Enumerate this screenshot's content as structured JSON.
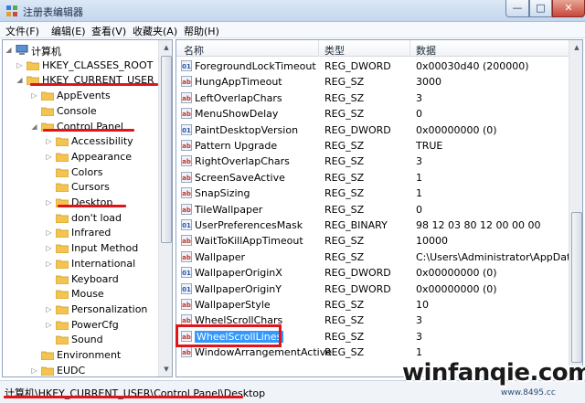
{
  "window": {
    "title": "注册表编辑器",
    "min_glyph": "—",
    "max_glyph": "□",
    "close_glyph": "✕"
  },
  "menu": [
    "文件(F)",
    "编辑(E)",
    "查看(V)",
    "收藏夹(A)",
    "帮助(H)"
  ],
  "tree": [
    {
      "label": "计算机",
      "level": 0,
      "expander": "◢",
      "icon": "computer-icon"
    },
    {
      "label": "HKEY_CLASSES_ROOT",
      "level": 1,
      "expander": "▷",
      "icon": "folder-icon"
    },
    {
      "label": "HKEY_CURRENT_USER",
      "level": 1,
      "expander": "◢",
      "icon": "folder-icon"
    },
    {
      "label": "AppEvents",
      "level": 2,
      "expander": "▷",
      "icon": "folder-icon"
    },
    {
      "label": "Console",
      "level": 2,
      "expander": "",
      "icon": "folder-icon"
    },
    {
      "label": "Control Panel",
      "level": 2,
      "expander": "◢",
      "icon": "folder-icon"
    },
    {
      "label": "Accessibility",
      "level": 3,
      "expander": "▷",
      "icon": "folder-icon"
    },
    {
      "label": "Appearance",
      "level": 3,
      "expander": "▷",
      "icon": "folder-icon"
    },
    {
      "label": "Colors",
      "level": 3,
      "expander": "",
      "icon": "folder-icon"
    },
    {
      "label": "Cursors",
      "level": 3,
      "expander": "",
      "icon": "folder-icon"
    },
    {
      "label": "Desktop",
      "level": 3,
      "expander": "▷",
      "icon": "folder-icon"
    },
    {
      "label": "don't load",
      "level": 3,
      "expander": "",
      "icon": "folder-icon"
    },
    {
      "label": "Infrared",
      "level": 3,
      "expander": "▷",
      "icon": "folder-icon"
    },
    {
      "label": "Input Method",
      "level": 3,
      "expander": "▷",
      "icon": "folder-icon"
    },
    {
      "label": "International",
      "level": 3,
      "expander": "▷",
      "icon": "folder-icon"
    },
    {
      "label": "Keyboard",
      "level": 3,
      "expander": "",
      "icon": "folder-icon"
    },
    {
      "label": "Mouse",
      "level": 3,
      "expander": "",
      "icon": "folder-icon"
    },
    {
      "label": "Personalization",
      "level": 3,
      "expander": "▷",
      "icon": "folder-icon"
    },
    {
      "label": "PowerCfg",
      "level": 3,
      "expander": "▷",
      "icon": "folder-icon"
    },
    {
      "label": "Sound",
      "level": 3,
      "expander": "",
      "icon": "folder-icon"
    },
    {
      "label": "Environment",
      "level": 2,
      "expander": "",
      "icon": "folder-icon"
    },
    {
      "label": "EUDC",
      "level": 2,
      "expander": "▷",
      "icon": "folder-icon"
    }
  ],
  "columns": {
    "name": "名称",
    "type": "类型",
    "data": "数据"
  },
  "values": [
    {
      "name": "ForegroundLockTimeout",
      "type": "REG_DWORD",
      "data": "0x00030d40 (200000)",
      "icon": "bin"
    },
    {
      "name": "HungAppTimeout",
      "type": "REG_SZ",
      "data": "3000",
      "icon": "sz"
    },
    {
      "name": "LeftOverlapChars",
      "type": "REG_SZ",
      "data": "3",
      "icon": "sz"
    },
    {
      "name": "MenuShowDelay",
      "type": "REG_SZ",
      "data": "0",
      "icon": "sz"
    },
    {
      "name": "PaintDesktopVersion",
      "type": "REG_DWORD",
      "data": "0x00000000 (0)",
      "icon": "bin"
    },
    {
      "name": "Pattern Upgrade",
      "type": "REG_SZ",
      "data": "TRUE",
      "icon": "sz"
    },
    {
      "name": "RightOverlapChars",
      "type": "REG_SZ",
      "data": "3",
      "icon": "sz"
    },
    {
      "name": "ScreenSaveActive",
      "type": "REG_SZ",
      "data": "1",
      "icon": "sz"
    },
    {
      "name": "SnapSizing",
      "type": "REG_SZ",
      "data": "1",
      "icon": "sz"
    },
    {
      "name": "TileWallpaper",
      "type": "REG_SZ",
      "data": "0",
      "icon": "sz"
    },
    {
      "name": "UserPreferencesMask",
      "type": "REG_BINARY",
      "data": "98 12 03 80 12 00 00 00",
      "icon": "bin"
    },
    {
      "name": "WaitToKillAppTimeout",
      "type": "REG_SZ",
      "data": "10000",
      "icon": "sz"
    },
    {
      "name": "Wallpaper",
      "type": "REG_SZ",
      "data": "C:\\Users\\Administrator\\AppData\\",
      "icon": "sz"
    },
    {
      "name": "WallpaperOriginX",
      "type": "REG_DWORD",
      "data": "0x00000000 (0)",
      "icon": "bin"
    },
    {
      "name": "WallpaperOriginY",
      "type": "REG_DWORD",
      "data": "0x00000000 (0)",
      "icon": "bin"
    },
    {
      "name": "WallpaperStyle",
      "type": "REG_SZ",
      "data": "10",
      "icon": "sz"
    },
    {
      "name": "WheelScrollChars",
      "type": "REG_SZ",
      "data": "3",
      "icon": "sz"
    },
    {
      "name": "WheelScrollLines",
      "type": "REG_SZ",
      "data": "3",
      "icon": "sz",
      "selected": true
    },
    {
      "name": "WindowArrangementActive",
      "type": "REG_SZ",
      "data": "1",
      "icon": "sz"
    }
  ],
  "status": {
    "path": "计算机\\HKEY_CURRENT_USER\\Control Panel\\Desktop"
  },
  "watermark": {
    "text": "winfanqie.com",
    "sub": "www.8495.cc"
  },
  "colors": {
    "highlight": "#e0151b",
    "selection": "#3399ff"
  }
}
